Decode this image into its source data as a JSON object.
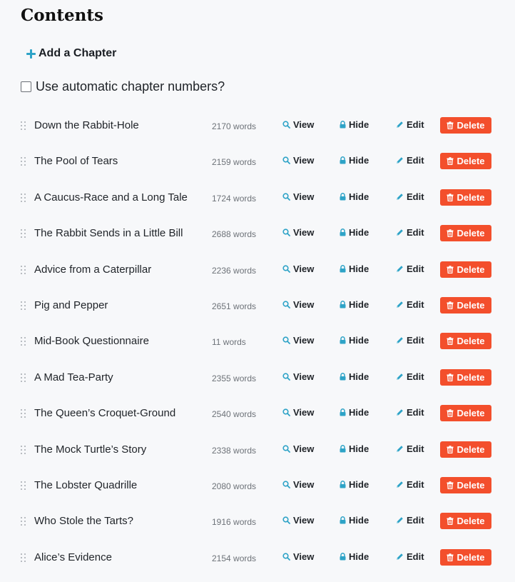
{
  "page_title": "Contents",
  "add_chapter_label": "Add a Chapter",
  "auto_numbers_label": "Use automatic chapter numbers?",
  "actions": {
    "view": "View",
    "hide": "Hide",
    "edit": "Edit",
    "delete": "Delete"
  },
  "colors": {
    "accent": "#2ea3c7",
    "delete": "#f34f2c"
  },
  "chapters": [
    {
      "title": "Down the Rabbit-Hole",
      "words": "2170 words"
    },
    {
      "title": "The Pool of Tears",
      "words": "2159 words"
    },
    {
      "title": "A Caucus-Race and a Long Tale",
      "words": "1724 words"
    },
    {
      "title": "The Rabbit Sends in a Little Bill",
      "words": "2688 words"
    },
    {
      "title": "Advice from a Caterpillar",
      "words": "2236 words"
    },
    {
      "title": "Pig and Pepper",
      "words": "2651 words"
    },
    {
      "title": "Mid-Book Questionnaire",
      "words": "11 words"
    },
    {
      "title": "A Mad Tea-Party",
      "words": "2355 words"
    },
    {
      "title": "The Queen’s Croquet-Ground",
      "words": "2540 words"
    },
    {
      "title": "The Mock Turtle’s Story",
      "words": "2338 words"
    },
    {
      "title": "The Lobster Quadrille",
      "words": "2080 words"
    },
    {
      "title": "Who Stole the Tarts?",
      "words": "1916 words"
    },
    {
      "title": "Alice’s Evidence",
      "words": "2154 words"
    }
  ]
}
